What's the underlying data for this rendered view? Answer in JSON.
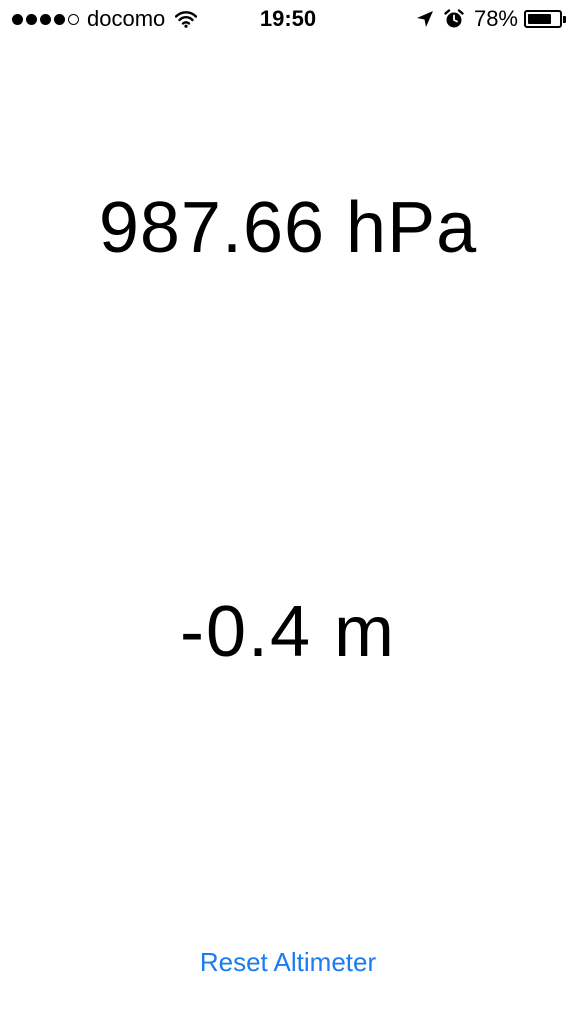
{
  "status_bar": {
    "carrier": "docomo",
    "signal_bars": 4,
    "signal_max": 5,
    "time": "19:50",
    "battery_percent": "78%",
    "battery_level": 0.78,
    "icons": [
      "wifi-icon",
      "location-arrow-icon",
      "alarm-clock-icon",
      "battery-icon"
    ]
  },
  "readings": {
    "pressure": "987.66 hPa",
    "altitude": "-0.4 m"
  },
  "actions": {
    "reset_label": "Reset Altimeter"
  },
  "colors": {
    "accent": "#1a7cf0",
    "text": "#000000",
    "background": "#ffffff"
  }
}
